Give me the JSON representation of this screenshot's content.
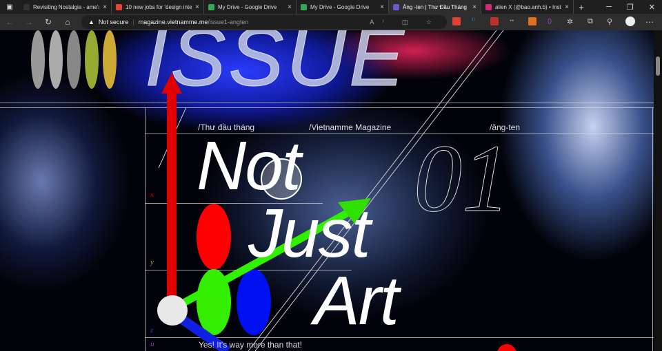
{
  "browser": {
    "tabs": [
      {
        "title": "Revisiting Nostalgia - ame's",
        "icon": "generic-icon",
        "color": "#333"
      },
      {
        "title": "10 new jobs for 'design inte",
        "icon": "gmail-icon",
        "color": "#ea4335"
      },
      {
        "title": "My Drive - Google Drive",
        "icon": "google-drive-icon",
        "color": "#34a853"
      },
      {
        "title": "My Drive - Google Drive",
        "icon": "google-drive-icon",
        "color": "#34a853"
      },
      {
        "title": "Ăng -ten | Thư Đầu Tháng",
        "icon": "angten-icon",
        "color": "#6a5acd",
        "active": true
      },
      {
        "title": "alien X (@bao.anh.b) • Insta",
        "icon": "instagram-icon",
        "color": "#d62976"
      }
    ],
    "security": "Not secure",
    "url_host": "magazine.vietnamme.me",
    "url_path": "/issue1-angten"
  },
  "page": {
    "header_word": "ISSUE",
    "meta": [
      "/Thư đầu tháng",
      "/Vietnamme Magazine",
      "/ăng-ten"
    ],
    "issue_number": "01",
    "headline": [
      "Not",
      "Just",
      "Art"
    ],
    "axes": [
      "x",
      "y",
      "z",
      "u"
    ],
    "tagline": "Yes! It's way more than that!"
  }
}
